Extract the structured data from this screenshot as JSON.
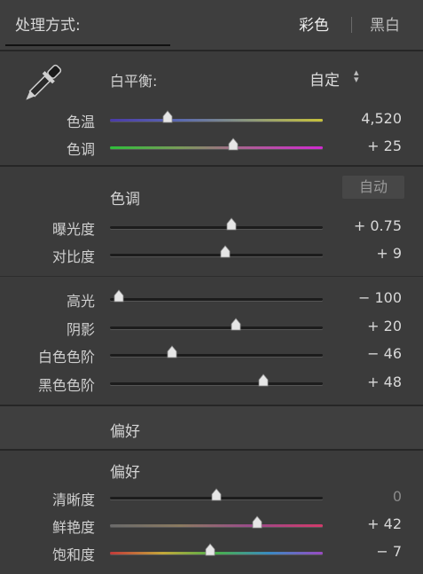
{
  "header": {
    "title": "处理方式:",
    "option_color": "彩色",
    "option_bw": "黑白"
  },
  "white_balance": {
    "label": "白平衡:",
    "value": "自定",
    "sliders": [
      {
        "label": "色温",
        "value": "4,520",
        "position": 0.27
      },
      {
        "label": "色调",
        "value": "+ 25",
        "position": 0.58
      }
    ]
  },
  "tone": {
    "title": "色调",
    "auto_label": "自动",
    "group1": [
      {
        "label": "曝光度",
        "value": "+ 0.75",
        "position": 0.57
      },
      {
        "label": "对比度",
        "value": "+ 9",
        "position": 0.54
      }
    ],
    "group2": [
      {
        "label": "高光",
        "value": "− 100",
        "position": 0.04
      },
      {
        "label": "阴影",
        "value": "+ 20",
        "position": 0.59
      },
      {
        "label": "白色色阶",
        "value": "− 46",
        "position": 0.29
      },
      {
        "label": "黑色色阶",
        "value": "+ 48",
        "position": 0.72
      }
    ]
  },
  "presence_collapsed": {
    "title": "偏好"
  },
  "presence": {
    "title": "偏好",
    "sliders": [
      {
        "label": "清晰度",
        "value": "0",
        "position": 0.5
      },
      {
        "label": "鲜艳度",
        "value": "+ 42",
        "position": 0.69
      },
      {
        "label": "饱和度",
        "value": "− 7",
        "position": 0.47
      }
    ]
  },
  "colors": {
    "accent_text": "#d8d8d8",
    "panel_bg": "#3b3b3b",
    "divider": "#262626"
  }
}
